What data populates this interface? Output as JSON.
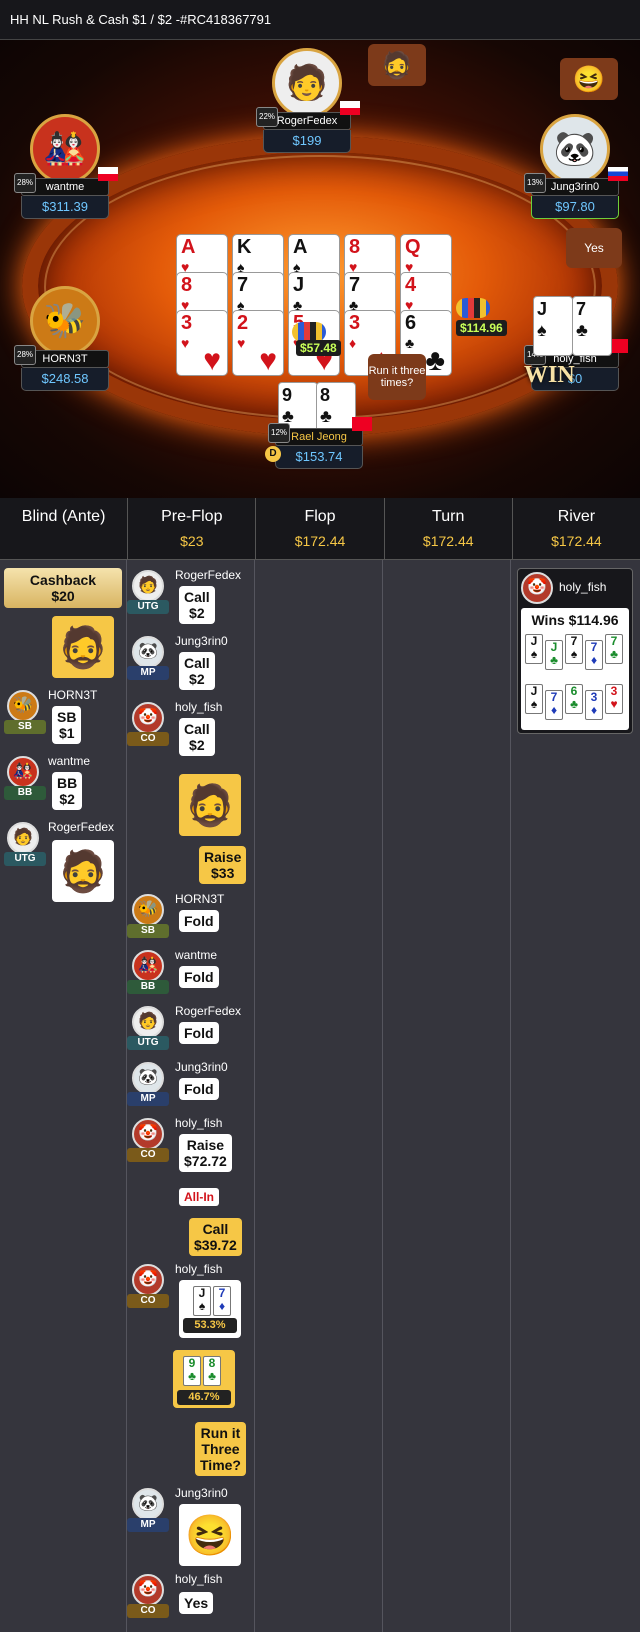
{
  "title": "HH NL Rush & Cash $1 / $2 -#RC418367791",
  "table": {
    "seats": {
      "roger": {
        "name": "RogerFedex",
        "stack": "$199",
        "pct": "22%"
      },
      "wantme": {
        "name": "wantme",
        "stack": "$311.39",
        "pct": "28%"
      },
      "jung": {
        "name": "Jung3rin0",
        "stack": "$97.80",
        "pct": "13%"
      },
      "horn": {
        "name": "HORN3T",
        "stack": "$248.58",
        "pct": "28%"
      },
      "holy": {
        "name": "holy_fish",
        "stack": "$0",
        "pct": "14%"
      },
      "rael": {
        "name": "Rael Jeong",
        "stack": "$153.74",
        "pct": "12%"
      }
    },
    "board": [
      [
        {
          "rank": "A",
          "suit": "♥",
          "color": "red"
        },
        {
          "rank": "8",
          "suit": "♥",
          "color": "red"
        },
        {
          "rank": "3",
          "suit": "♥",
          "color": "red"
        }
      ],
      [
        {
          "rank": "K",
          "suit": "♠",
          "color": "blk"
        },
        {
          "rank": "7",
          "suit": "♠",
          "color": "blk"
        },
        {
          "rank": "2",
          "suit": "♥",
          "color": "red"
        }
      ],
      [
        {
          "rank": "A",
          "suit": "♠",
          "color": "blk"
        },
        {
          "rank": "J",
          "suit": "♣",
          "color": "blk"
        },
        {
          "rank": "5",
          "suit": "♥",
          "color": "red"
        }
      ],
      [
        {
          "rank": "8",
          "suit": "♥",
          "color": "red"
        },
        {
          "rank": "7",
          "suit": "♣",
          "color": "blk"
        },
        {
          "rank": "3",
          "suit": "♦",
          "color": "red"
        }
      ],
      [
        {
          "rank": "Q",
          "suit": "♥",
          "color": "red"
        },
        {
          "rank": "4",
          "suit": "♥",
          "color": "red"
        },
        {
          "rank": "6",
          "suit": "♣",
          "color": "blk"
        }
      ]
    ],
    "pot_main": "$57.48",
    "pot_side": "$114.96",
    "bubble_run": "Run it three times?",
    "bubble_yes": "Yes",
    "win_text": "WIN",
    "dealer": "D",
    "holy_cards": [
      {
        "rank": "J",
        "suit": "♠"
      },
      {
        "rank": "7",
        "suit": "♣"
      }
    ],
    "rael_cards": [
      {
        "rank": "9",
        "suit": "♣"
      },
      {
        "rank": "8",
        "suit": "♣"
      }
    ]
  },
  "streets": [
    {
      "name": "Blind (Ante)",
      "pot": ""
    },
    {
      "name": "Pre-Flop",
      "pot": "$23"
    },
    {
      "name": "Flop",
      "pot": "$172.44"
    },
    {
      "name": "Turn",
      "pot": "$172.44"
    },
    {
      "name": "River",
      "pot": "$172.44"
    }
  ],
  "blind": {
    "cashback": "Cashback",
    "cashback_amt": "$20",
    "rows": [
      {
        "name": "HORN3T",
        "pos": "SB",
        "action": "SB",
        "amount": "$1"
      },
      {
        "name": "wantme",
        "pos": "BB",
        "action": "BB",
        "amount": "$2"
      },
      {
        "name": "RogerFedex",
        "pos": "UTG"
      }
    ]
  },
  "preflop": {
    "r1": {
      "name": "RogerFedex",
      "pos": "UTG",
      "action": "Call",
      "amount": "$2"
    },
    "r2": {
      "name": "Jung3rin0",
      "pos": "MP",
      "action": "Call",
      "amount": "$2"
    },
    "r3": {
      "name": "holy_fish",
      "pos": "CO",
      "action": "Call",
      "amount": "$2"
    },
    "hero_raise": {
      "action": "Raise",
      "amount": "$33"
    },
    "r4": {
      "name": "HORN3T",
      "pos": "SB",
      "action": "Fold"
    },
    "r5": {
      "name": "wantme",
      "pos": "BB",
      "action": "Fold"
    },
    "r6": {
      "name": "RogerFedex",
      "pos": "UTG",
      "action": "Fold"
    },
    "r7": {
      "name": "Jung3rin0",
      "pos": "MP",
      "action": "Fold"
    },
    "r8": {
      "name": "holy_fish",
      "pos": "CO",
      "action": "Raise",
      "amount": "$72.72",
      "allin": "All-In"
    },
    "hero_call": {
      "action": "Call",
      "amount": "$39.72"
    },
    "r9": {
      "name": "holy_fish",
      "pos": "CO",
      "cards": [
        {
          "rank": "J",
          "suit": "♠",
          "color": "blk"
        },
        {
          "rank": "7",
          "suit": "♦",
          "color": "blu"
        }
      ],
      "equity": "53.3%"
    },
    "hero_show": {
      "cards": [
        {
          "rank": "9",
          "suit": "♣",
          "color": "grn"
        },
        {
          "rank": "8",
          "suit": "♣",
          "color": "grn"
        }
      ],
      "equity": "46.7%"
    },
    "hero_run": {
      "l1": "Run it",
      "l2": "Three",
      "l3": "Time?"
    },
    "r10": {
      "name": "Jung3rin0",
      "pos": "MP"
    },
    "r11": {
      "name": "holy_fish",
      "pos": "CO",
      "action": "Yes"
    }
  },
  "river": {
    "name": "holy_fish",
    "wins": "Wins $114.96",
    "run1": [
      {
        "rank": "J",
        "suit": "♠",
        "color": "blk"
      },
      {
        "rank": "J",
        "suit": "♣",
        "color": "grn"
      },
      {
        "rank": "7",
        "suit": "♠",
        "color": "blk"
      },
      {
        "rank": "7",
        "suit": "♦",
        "color": "blu"
      },
      {
        "rank": "7",
        "suit": "♣",
        "color": "grn"
      }
    ],
    "run2": [
      {
        "rank": "J",
        "suit": "♠",
        "color": "blk"
      },
      {
        "rank": "7",
        "suit": "♦",
        "color": "blu"
      },
      {
        "rank": "6",
        "suit": "♣",
        "color": "grn"
      },
      {
        "rank": "3",
        "suit": "♦",
        "color": "blu"
      },
      {
        "rank": "3",
        "suit": "♥",
        "color": "red"
      }
    ]
  }
}
